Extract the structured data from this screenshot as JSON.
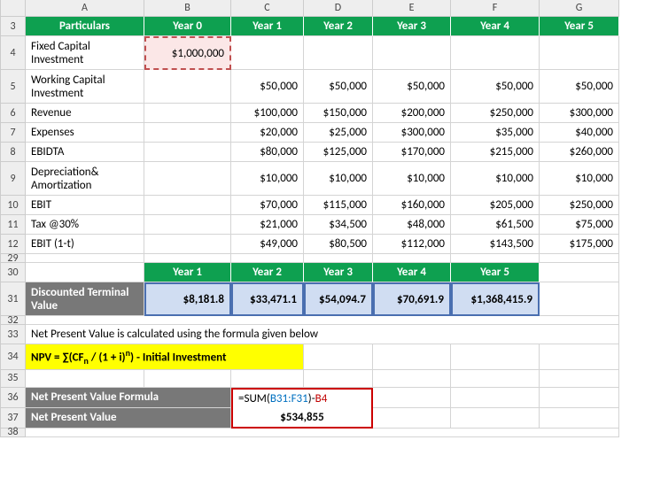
{
  "colHeaders": [
    "A",
    "B",
    "C",
    "D",
    "E",
    "F",
    "G"
  ],
  "rowNums": [
    "3",
    "4",
    "5",
    "6",
    "7",
    "8",
    "9",
    "10",
    "11",
    "12",
    "29",
    "30",
    "31",
    "32",
    "33",
    "34",
    "35",
    "36",
    "37",
    "38"
  ],
  "t1": {
    "header": [
      "Particulars",
      "Year 0",
      "Year 1",
      "Year 2",
      "Year 3",
      "Year 4",
      "Year 5"
    ],
    "r4_label": "Fixed Capital Investment",
    "r4_b": "$1,000,000",
    "r5_label": "Working Capital Investment",
    "r5": [
      "$50,000",
      "$50,000",
      "$50,000",
      "$50,000",
      "$50,000"
    ],
    "r6_label": "Revenue",
    "r6": [
      "$100,000",
      "$150,000",
      "$200,000",
      "$250,000",
      "$300,000"
    ],
    "r7_label": "Expenses",
    "r7": [
      "$20,000",
      "$25,000",
      "$300,000",
      "$35,000",
      "$40,000"
    ],
    "r8_label": "EBIDTA",
    "r8": [
      "$80,000",
      "$125,000",
      "$170,000",
      "$215,000",
      "$260,000"
    ],
    "r9_label": "Depreciation& Amortization",
    "r9": [
      "$10,000",
      "$10,000",
      "$10,000",
      "$10,000",
      "$10,000"
    ],
    "r10_label": "EBIT",
    "r10": [
      "$70,000",
      "$115,000",
      "$160,000",
      "$205,000",
      "$250,000"
    ],
    "r11_label": "Tax @30%",
    "r11": [
      "$21,000",
      "$34,500",
      "$48,000",
      "$61,500",
      "$75,000"
    ],
    "r12_label": "EBIT (1-t)",
    "r12": [
      "$49,000",
      "$80,500",
      "$112,000",
      "$143,500",
      "$175,000"
    ]
  },
  "t2": {
    "header": [
      "Year 1",
      "Year 2",
      "Year 3",
      "Year 4",
      "Year 5"
    ],
    "label": "Discounted Terminal Value",
    "vals": [
      "$8,181.8",
      "$33,471.1",
      "$54,094.7",
      "$70,691.9",
      "$1,368,415.9"
    ]
  },
  "note": "Net Present Value is calculated using the formula given below",
  "npv_formula_text": "NPV = ∑(CFₙ / (1 + i)ⁿ) - Initial Investment",
  "npv_formula_label": "Net Present Value Formula",
  "npv_label": "Net Present Value",
  "npv_formula_expr": {
    "eq": "=",
    "fn": "SUM(",
    "range": "B31:F31",
    "close": ")-",
    "ref": "B4"
  },
  "npv_value": "$534,855"
}
